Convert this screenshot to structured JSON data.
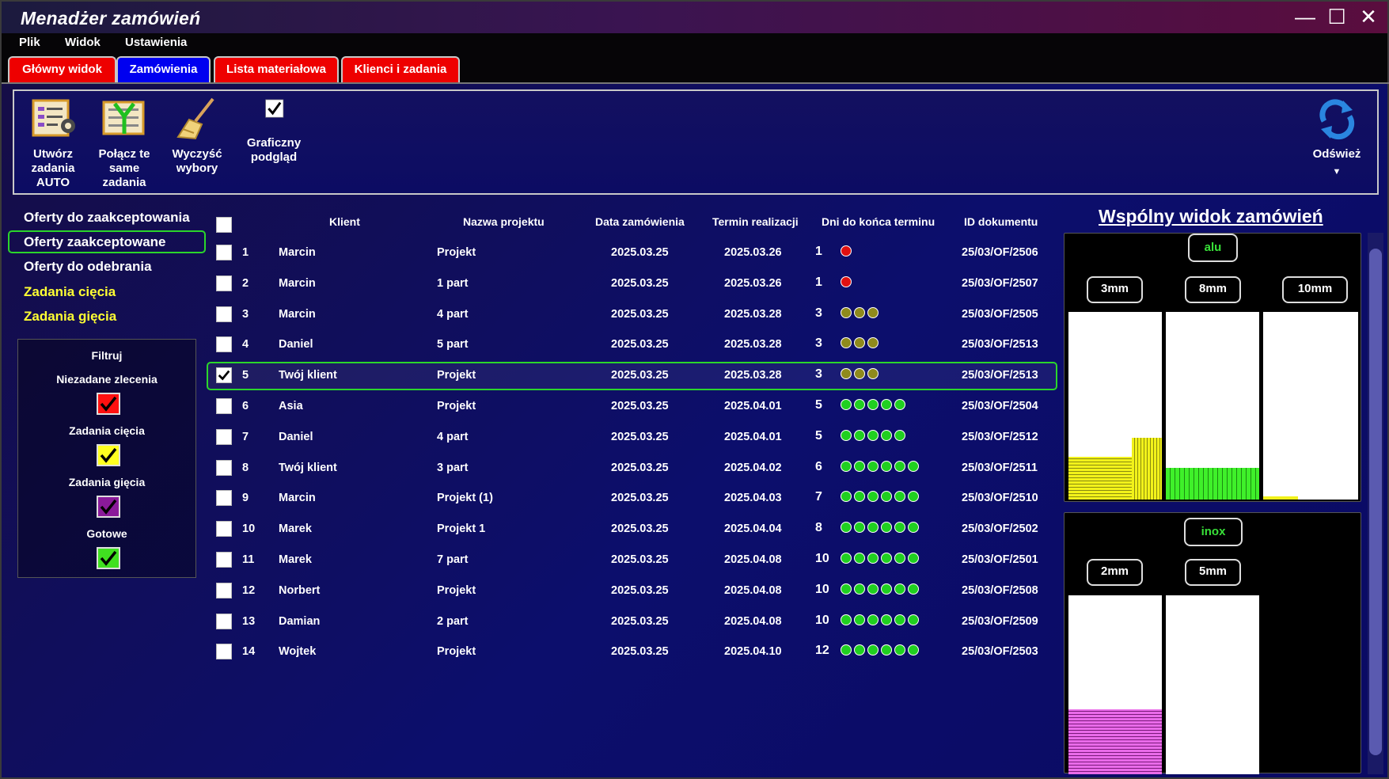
{
  "app": {
    "title": "Menadżer zamówień"
  },
  "menu": [
    "Plik",
    "Widok",
    "Ustawienia"
  ],
  "tabs": [
    "Główny widok",
    "Zamówienia",
    "Lista materiałowa",
    "Klienci i zadania"
  ],
  "colors": {
    "tab_red": "#ff0000",
    "tab_blue": "#0000ff",
    "sel_green": "#2bd62b",
    "accent_yellow": "#ffff33"
  },
  "ribbon": {
    "create_auto": "Utwórz zadania AUTO",
    "merge": "Połącz te same zadania",
    "clear": "Wyczyść wybory",
    "graphic": "Graficzny podgląd",
    "refresh": "Odśwież"
  },
  "nav": [
    "Oferty do zaakceptowania",
    "Oferty zaakceptowane",
    "Oferty do odebrania",
    "Zadania cięcia",
    "Zadania gięcia"
  ],
  "filter": {
    "title": "Filtruj",
    "items": [
      "Niezadane zlecenia",
      "Zadania cięcia",
      "Zadania gięcia",
      "Gotowe"
    ],
    "colors": [
      "#ff1010",
      "#ffff20",
      "#8a1a9a",
      "#40e020"
    ]
  },
  "table": {
    "headers": [
      "Klient",
      "Nazwa projektu",
      "Data zamówienia",
      "Termin realizacji",
      "Dni do końca terminu",
      "ID dokumentu"
    ],
    "rows": [
      {
        "n": "1",
        "client": "Marcin",
        "project": "Projekt",
        "ordered": "2025.03.25",
        "due": "2025.03.26",
        "days": "1",
        "id": "25/03/OF/2506",
        "checked": false,
        "dots": 1,
        "dot_color": "#e01010"
      },
      {
        "n": "2",
        "client": "Marcin",
        "project": "1 part",
        "ordered": "2025.03.25",
        "due": "2025.03.26",
        "days": "1",
        "id": "25/03/OF/2507",
        "checked": false,
        "dots": 1,
        "dot_color": "#e01010"
      },
      {
        "n": "3",
        "client": "Marcin",
        "project": "4 part",
        "ordered": "2025.03.25",
        "due": "2025.03.28",
        "days": "3",
        "id": "25/03/OF/2505",
        "checked": false,
        "dots": 3,
        "dot_color": "#8f8a1c"
      },
      {
        "n": "4",
        "client": "Daniel",
        "project": "5 part",
        "ordered": "2025.03.25",
        "due": "2025.03.28",
        "days": "3",
        "id": "25/03/OF/2513",
        "checked": false,
        "dots": 3,
        "dot_color": "#8f8a1c"
      },
      {
        "n": "5",
        "client": "Twój klient",
        "project": "Projekt",
        "ordered": "2025.03.25",
        "due": "2025.03.28",
        "days": "3",
        "id": "25/03/OF/2513",
        "checked": true,
        "dots": 3,
        "dot_color": "#8f8a1c"
      },
      {
        "n": "6",
        "client": "Asia",
        "project": "Projekt",
        "ordered": "2025.03.25",
        "due": "2025.04.01",
        "days": "5",
        "id": "25/03/OF/2504",
        "checked": false,
        "dots": 5,
        "dot_color": "#20d020"
      },
      {
        "n": "7",
        "client": "Daniel",
        "project": "4 part",
        "ordered": "2025.03.25",
        "due": "2025.04.01",
        "days": "5",
        "id": "25/03/OF/2512",
        "checked": false,
        "dots": 5,
        "dot_color": "#20d020"
      },
      {
        "n": "8",
        "client": "Twój klient",
        "project": "3 part",
        "ordered": "2025.03.25",
        "due": "2025.04.02",
        "days": "6",
        "id": "25/03/OF/2511",
        "checked": false,
        "dots": 6,
        "dot_color": "#20d020"
      },
      {
        "n": "9",
        "client": "Marcin",
        "project": "Projekt (1)",
        "ordered": "2025.03.25",
        "due": "2025.04.03",
        "days": "7",
        "id": "25/03/OF/2510",
        "checked": false,
        "dots": 6,
        "dot_color": "#20d020"
      },
      {
        "n": "10",
        "client": "Marek",
        "project": "Projekt 1",
        "ordered": "2025.03.25",
        "due": "2025.04.04",
        "days": "8",
        "id": "25/03/OF/2502",
        "checked": false,
        "dots": 6,
        "dot_color": "#20d020"
      },
      {
        "n": "11",
        "client": "Marek",
        "project": "7 part",
        "ordered": "2025.03.25",
        "due": "2025.04.08",
        "days": "10",
        "id": "25/03/OF/2501",
        "checked": false,
        "dots": 6,
        "dot_color": "#20d020"
      },
      {
        "n": "12",
        "client": "Norbert",
        "project": "Projekt",
        "ordered": "2025.03.25",
        "due": "2025.04.08",
        "days": "10",
        "id": "25/03/OF/2508",
        "checked": false,
        "dots": 6,
        "dot_color": "#20d020"
      },
      {
        "n": "13",
        "client": "Damian",
        "project": "2 part",
        "ordered": "2025.03.25",
        "due": "2025.04.08",
        "days": "10",
        "id": "25/03/OF/2509",
        "checked": false,
        "dots": 6,
        "dot_color": "#20d020"
      },
      {
        "n": "14",
        "client": "Wojtek",
        "project": "Projekt",
        "ordered": "2025.03.25",
        "due": "2025.04.10",
        "days": "12",
        "id": "25/03/OF/2503",
        "checked": false,
        "dots": 6,
        "dot_color": "#20d020"
      }
    ]
  },
  "preview": {
    "title": "Wspólny widok zamówień",
    "groups": [
      {
        "material": "alu",
        "thicknesses": [
          "3mm",
          "8mm",
          "10mm"
        ]
      },
      {
        "material": "inox",
        "thicknesses": [
          "2mm",
          "5mm"
        ]
      }
    ]
  }
}
